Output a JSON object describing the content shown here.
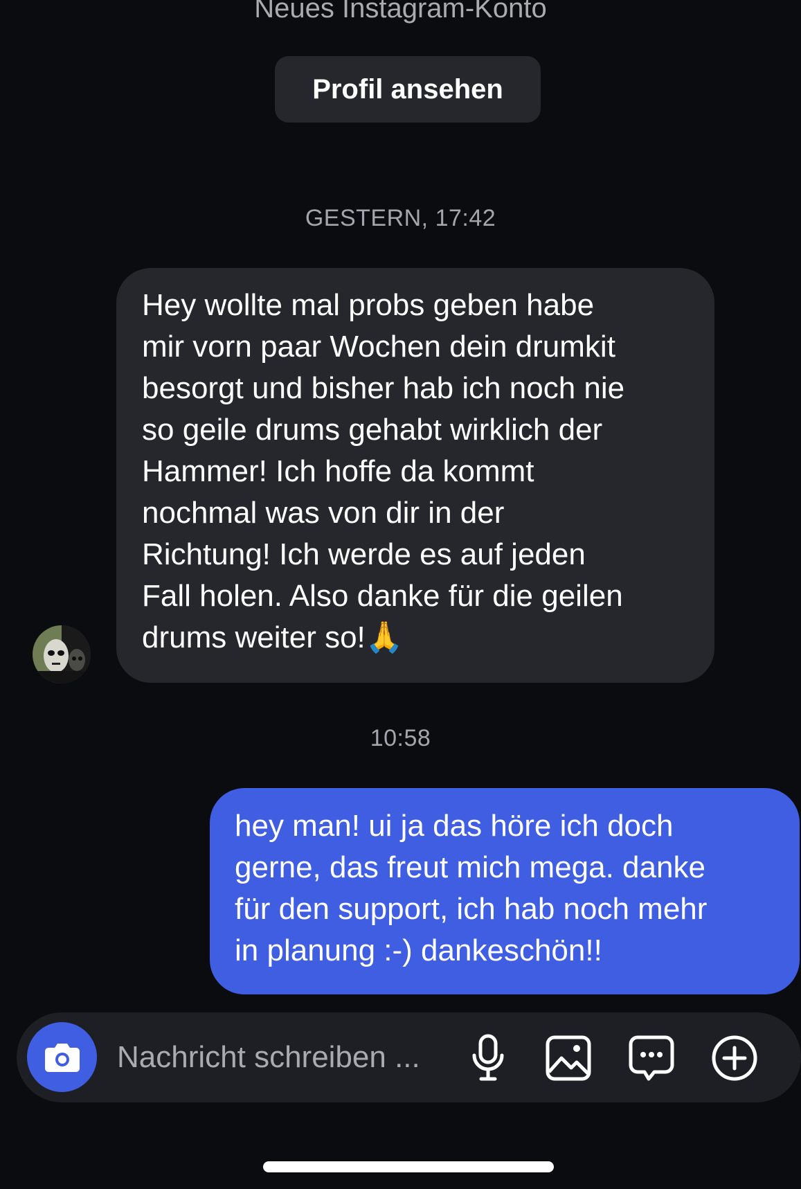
{
  "header": {
    "subtitle": "Neues Instagram-Konto",
    "profile_button_label": "Profil ansehen"
  },
  "messages": [
    {
      "timestamp": "GESTERN, 17:42",
      "direction": "incoming",
      "text": "Hey wollte mal probs geben habe\nmir vorn paar Wochen dein drumkit\nbesorgt und bisher hab ich noch nie\nso geile drums gehabt wirklich der\nHammer! Ich hoffe da kommt\nnochmal was von dir in der\nRichtung! Ich werde es auf jeden\nFall holen. Also danke für die geilen\ndrums weiter so!🙏"
    },
    {
      "timestamp": "10:58",
      "direction": "outgoing",
      "text": "hey man! ui ja das höre ich doch\ngerne, das freut mich mega. danke\nfür den support, ich hab noch mehr\nin planung :-) dankeschön!!"
    }
  ],
  "composer": {
    "placeholder": "Nachricht schreiben ...",
    "icons": [
      "camera-icon",
      "microphone-icon",
      "image-icon",
      "sticker-icon",
      "plus-circle-icon"
    ]
  },
  "colors": {
    "background": "#0b0c10",
    "incoming_bubble": "#25272d",
    "outgoing_bubble": "#3f5ee1",
    "composer": "#1d1f24",
    "muted_text": "#a9abb1"
  }
}
